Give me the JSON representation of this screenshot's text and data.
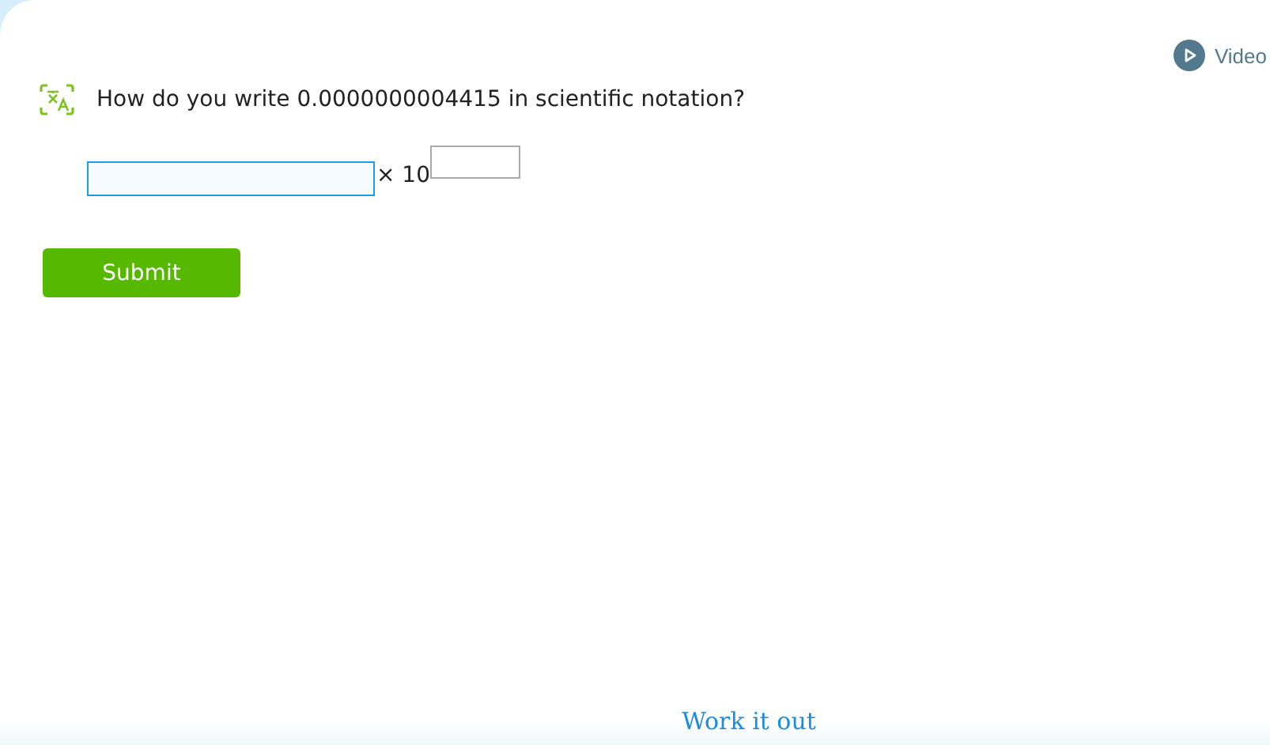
{
  "video_link": {
    "label": "Video"
  },
  "question": {
    "text": "How do you write 0.0000000004415 in scientific notation?"
  },
  "answer": {
    "coefficient": {
      "focused": true
    },
    "times_label": "× 10",
    "exponent": {
      "focused": false
    }
  },
  "submit_button": {
    "label": "Submit"
  },
  "work_it_out": {
    "label": "Work it out"
  }
}
